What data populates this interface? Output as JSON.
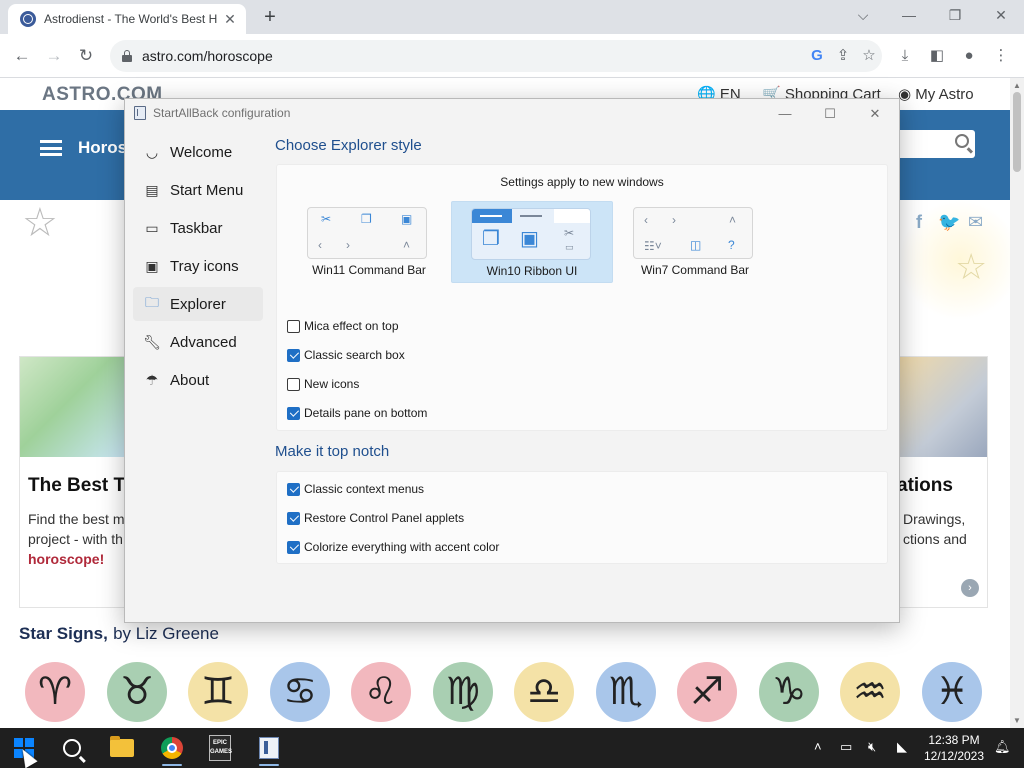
{
  "browser": {
    "tab_title": "Astrodienst - The World's Best H",
    "url": "astro.com/horoscope",
    "window_controls": [
      "⌵",
      "—",
      "❐",
      "✕"
    ]
  },
  "website": {
    "logo": "ASTRO.COM",
    "lang": "EN",
    "cart": "Shopping Cart",
    "my_astro": "My Astro",
    "nav_label": "Horosc",
    "card_left": {
      "title": "The Best Ti",
      "line1": "Find the best m",
      "line2": "project - with th",
      "link": "horoscope!"
    },
    "card_right": {
      "title": "ations",
      "line1": "Drawings,",
      "line2": "ctions and"
    },
    "star_signs_title": "Star Signs,",
    "star_signs_by": "by Liz Greene",
    "signs": [
      {
        "glyph": "♈",
        "color": "#f2b8be"
      },
      {
        "glyph": "♉",
        "color": "#a9cfb2"
      },
      {
        "glyph": "♊",
        "color": "#f4e2a7"
      },
      {
        "glyph": "♋",
        "color": "#a9c6ea"
      },
      {
        "glyph": "♌",
        "color": "#f2b8be"
      },
      {
        "glyph": "♍",
        "color": "#a9cfb2"
      },
      {
        "glyph": "♎",
        "color": "#f4e2a7"
      },
      {
        "glyph": "♏",
        "color": "#a9c6ea"
      },
      {
        "glyph": "♐",
        "color": "#f2b8be"
      },
      {
        "glyph": "♑",
        "color": "#a9cfb2"
      },
      {
        "glyph": "♒",
        "color": "#f4e2a7"
      },
      {
        "glyph": "♓",
        "color": "#a9c6ea"
      }
    ]
  },
  "dialog": {
    "title": "StartAllBack configuration",
    "nav": [
      {
        "label": "Welcome",
        "icon": "smile-icon"
      },
      {
        "label": "Start Menu",
        "icon": "start-menu-icon"
      },
      {
        "label": "Taskbar",
        "icon": "taskbar-icon"
      },
      {
        "label": "Tray icons",
        "icon": "tray-icon"
      },
      {
        "label": "Explorer",
        "icon": "folder-icon",
        "selected": true
      },
      {
        "label": "Advanced",
        "icon": "wrench-icon"
      },
      {
        "label": "About",
        "icon": "umbrella-icon"
      }
    ],
    "explorer_section_title": "Choose Explorer style",
    "settings_note": "Settings apply to new windows",
    "styles": [
      {
        "label": "Win11 Command Bar",
        "selected": false
      },
      {
        "label": "Win10 Ribbon UI",
        "selected": true
      },
      {
        "label": "Win7 Command Bar",
        "selected": false
      }
    ],
    "explorer_options": [
      {
        "label": "Mica effect on top",
        "checked": false
      },
      {
        "label": "Classic search box",
        "checked": true
      },
      {
        "label": "New icons",
        "checked": false
      },
      {
        "label": "Details pane on bottom",
        "checked": true
      }
    ],
    "topnotch_section_title": "Make it top notch",
    "topnotch_options": [
      {
        "label": "Classic context menus",
        "checked": true
      },
      {
        "label": "Restore Control Panel applets",
        "checked": true
      },
      {
        "label": "Colorize everything with accent color",
        "checked": true
      }
    ]
  },
  "taskbar": {
    "time": "12:38 PM",
    "date": "12/12/2023",
    "epic_label": "EPIC GAMES"
  }
}
